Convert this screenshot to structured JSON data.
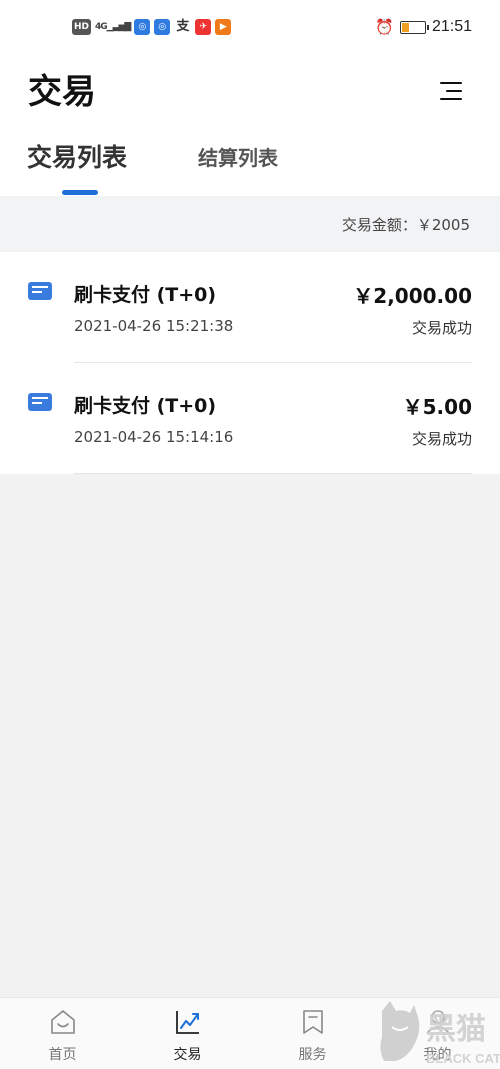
{
  "status_bar": {
    "time": "21:51",
    "hd": "HD",
    "network": "4G",
    "battery_level": 0.3
  },
  "header": {
    "title": "交易"
  },
  "tabs": [
    {
      "label": "交易列表",
      "active": true
    },
    {
      "label": "结算列表",
      "active": false
    }
  ],
  "summary": {
    "text": "交易金额：￥2005"
  },
  "transactions": [
    {
      "title": "刷卡支付 (T+0)",
      "time": "2021-04-26 15:21:38",
      "amount": "￥2,000.00",
      "status": "交易成功"
    },
    {
      "title": "刷卡支付 (T+0)",
      "time": "2021-04-26 15:14:16",
      "amount": "￥5.00",
      "status": "交易成功"
    }
  ],
  "tab_bar": [
    {
      "label": "首页",
      "icon": "home-icon",
      "active": false
    },
    {
      "label": "交易",
      "icon": "chart-icon",
      "active": true
    },
    {
      "label": "服务",
      "icon": "bookmark-icon",
      "active": false
    },
    {
      "label": "我的",
      "icon": "user-icon",
      "active": false
    }
  ],
  "watermark": {
    "text_cn": "黑猫",
    "text_en": "BLACK CAT"
  },
  "colors": {
    "accent": "#1e6fd9",
    "card_icon": "#3a7be0"
  }
}
